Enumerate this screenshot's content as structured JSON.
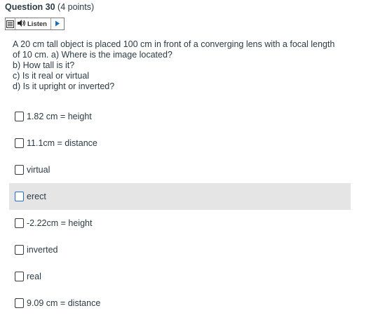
{
  "question": {
    "title": "Question 30",
    "points": "(4 points)"
  },
  "listen_toolbar": {
    "doc_icon": "document-icon",
    "speaker_icon": "speaker-icon",
    "listen_label": "Listen",
    "play_icon": "play-icon"
  },
  "question_text": {
    "lines": [
      "A 20 cm tall object is placed 100 cm in front of a converging lens with a focal length",
      "of 10 cm. a)  Where is the image located?",
      "b)  How tall is it?",
      "c)  Is it real or virtual",
      "d)  Is it upright or inverted?"
    ]
  },
  "answers": [
    {
      "label": "1.82 cm = height",
      "checked": false
    },
    {
      "label": "11.1cm = distance",
      "checked": false
    },
    {
      "label": "virtual",
      "checked": false
    },
    {
      "label": "erect",
      "checked": false
    },
    {
      "label": "-2.22cm = height",
      "checked": false
    },
    {
      "label": "inverted",
      "checked": false
    },
    {
      "label": "real",
      "checked": false
    },
    {
      "label": "9.09 cm = distance",
      "checked": false
    }
  ],
  "colors": {
    "text": "#2d3b45",
    "highlight_row": "#e5e5e5",
    "focus_checkbox": "#2a6ebd"
  }
}
